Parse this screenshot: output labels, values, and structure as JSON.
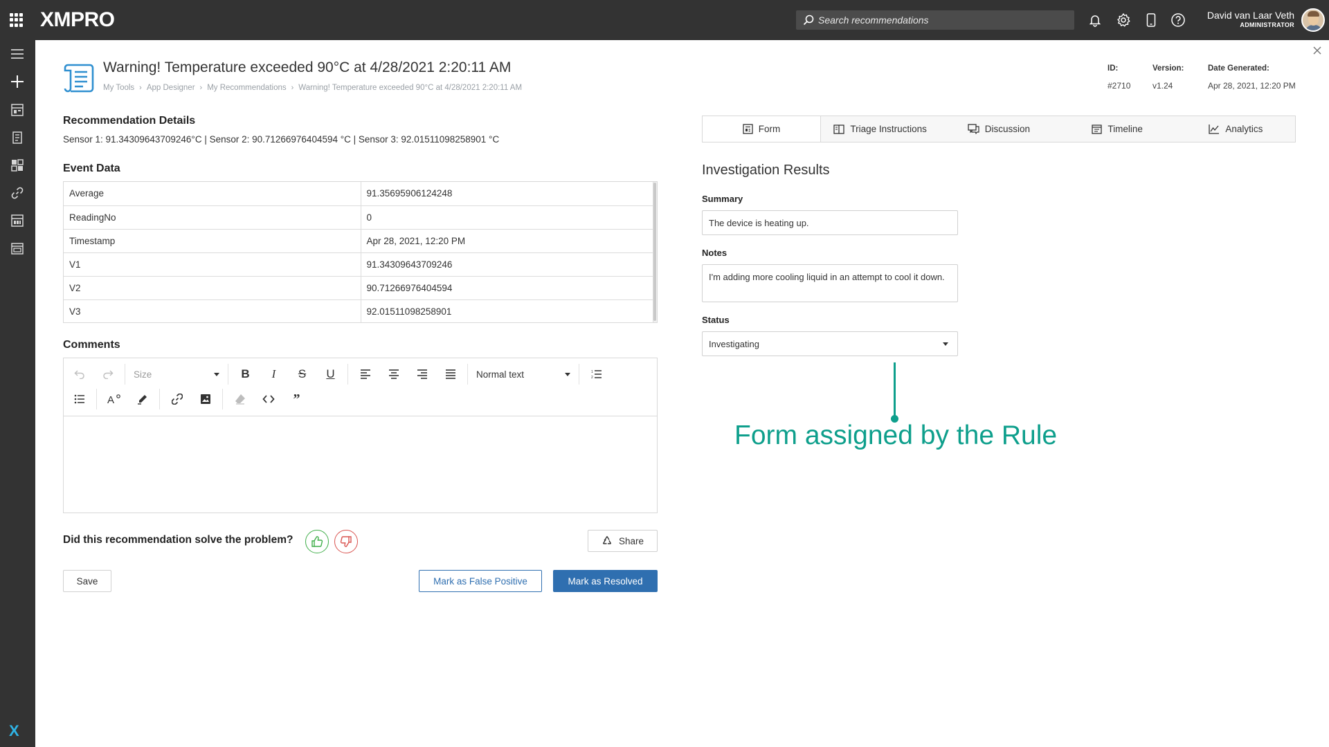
{
  "topbar": {
    "logo": "XMPRO",
    "search_placeholder": "Search recommendations",
    "user_name": "David van Laar Veth",
    "user_role": "ADMINISTRATOR"
  },
  "header": {
    "title": "Warning! Temperature exceeded 90°C at 4/28/2021 2:20:11 AM",
    "breadcrumb": [
      "My Tools",
      "App Designer",
      "My Recommendations",
      "Warning! Temperature exceeded 90°C at 4/28/2021 2:20:11 AM"
    ],
    "id_label": "ID:",
    "id_value": "#2710",
    "version_label": "Version:",
    "version_value": "v1.24",
    "date_label": "Date Generated:",
    "date_value": "Apr 28, 2021, 12:20 PM"
  },
  "details": {
    "heading": "Recommendation Details",
    "text": "Sensor 1: 91.34309643709246°C | Sensor 2: 90.71266976404594 °C | Sensor 3: 92.01511098258901 °C"
  },
  "event_data": {
    "heading": "Event Data",
    "rows": [
      {
        "key": "Average",
        "value": "91.35695906124248"
      },
      {
        "key": "ReadingNo",
        "value": "0"
      },
      {
        "key": "Timestamp",
        "value": "Apr 28, 2021, 12:20 PM"
      },
      {
        "key": "V1",
        "value": "91.34309643709246"
      },
      {
        "key": "V2",
        "value": "90.71266976404594"
      },
      {
        "key": "V3",
        "value": "92.01511098258901"
      }
    ]
  },
  "comments": {
    "heading": "Comments",
    "size_label": "Size",
    "format_label": "Normal text"
  },
  "feedback": {
    "question": "Did this recommendation solve the problem?",
    "share_label": "Share"
  },
  "actions": {
    "save": "Save",
    "false_positive": "Mark as False Positive",
    "resolved": "Mark as Resolved"
  },
  "tabs": [
    "Form",
    "Triage Instructions",
    "Discussion",
    "Timeline",
    "Analytics"
  ],
  "form": {
    "title": "Investigation Results",
    "summary_label": "Summary",
    "summary_value": "The device is heating up.",
    "notes_label": "Notes",
    "notes_value": "I'm adding more cooling liquid in an attempt to cool it down.",
    "status_label": "Status",
    "status_value": "Investigating"
  },
  "annotation": "Form assigned by the Rule",
  "colors": {
    "topbar": "#333333",
    "primary": "#2f6fb0",
    "annotation": "#0e9f8c",
    "thumbs_up": "#3fae49",
    "thumbs_down": "#d9534f"
  }
}
